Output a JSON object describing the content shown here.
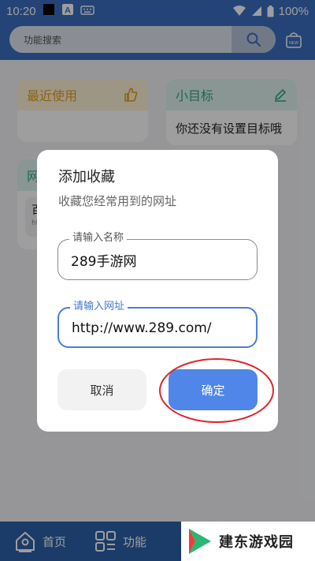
{
  "status_bar": {
    "time": "10:20",
    "battery": "100%"
  },
  "search": {
    "placeholder": "功能搜索"
  },
  "cards": {
    "recent": {
      "title": "最近使用"
    },
    "goal": {
      "title": "小目标",
      "empty_text": "你还没有设置目标哦"
    },
    "web": {
      "title": "网",
      "item_name": "百",
      "item_url": "ht"
    }
  },
  "dialog": {
    "title": "添加收藏",
    "subtitle": "收藏您经常用到的网址",
    "name_field": {
      "label": "请输入名称",
      "value": "289手游网"
    },
    "url_field": {
      "label": "请输入网址",
      "value": "http://www.289.com/"
    },
    "cancel_label": "取消",
    "confirm_label": "确定"
  },
  "bottom_nav": {
    "home_label": "首页",
    "func_label": "功能"
  },
  "watermark": {
    "text": "建东游戏园"
  },
  "colors": {
    "primary": "#3a6fc0",
    "confirm": "#4f86e8",
    "highlight_circle": "#e0232b"
  }
}
